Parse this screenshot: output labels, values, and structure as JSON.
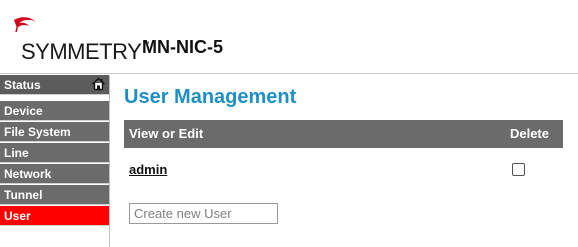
{
  "brand": {
    "logo_text": "SYMMETRY",
    "trademark": "™",
    "product_name": "MN-NIC-5",
    "logo_color": "#d0021b"
  },
  "sidebar": {
    "items": [
      {
        "label": "Status",
        "active": false,
        "icon": "home-icon"
      },
      {
        "label": "Device",
        "active": false
      },
      {
        "label": "File System",
        "active": false
      },
      {
        "label": "Line",
        "active": false
      },
      {
        "label": "Network",
        "active": false
      },
      {
        "label": "Tunnel",
        "active": false
      },
      {
        "label": "User",
        "active": true
      }
    ]
  },
  "main": {
    "title": "User Management",
    "table": {
      "headers": {
        "view_edit": "View or Edit",
        "delete": "Delete"
      },
      "rows": [
        {
          "user": "admin",
          "delete_checked": false
        }
      ]
    },
    "new_user": {
      "value": "",
      "placeholder": "Create new User"
    }
  },
  "colors": {
    "accent_title": "#1f8fc7",
    "nav_bg": "#6b6b6b",
    "nav_active": "#ff0000",
    "table_header_bg": "#6b6b6b"
  }
}
